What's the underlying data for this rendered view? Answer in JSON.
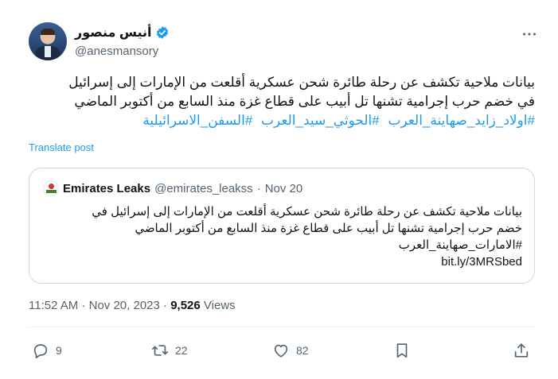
{
  "author": {
    "display_name": "أنيس منصور",
    "handle": "@anesmansory",
    "verified": true
  },
  "tweet": {
    "lines": [
      "بيانات ملاحية تكشف عن رحلة طائرة شحن عسكرية أقلعت من الإمارات إلى إسرائيل",
      "في خضم حرب إجرامية تشنها تل أبيب على قطاع غزة منذ السابع من أكتوبر الماضي"
    ],
    "hashtags": [
      "#اولاد_زايد_صهاينة_العرب",
      "#الحوثي_سيد_العرب",
      "#السفن_الاسرائيلية"
    ],
    "translate_label": "Translate post"
  },
  "quote": {
    "display_name": "Emirates Leaks",
    "handle": "@emirates_leakss",
    "separator": "·",
    "date": "Nov 20",
    "lines": [
      "بيانات ملاحية تكشف عن رحلة طائرة شحن عسكرية أقلعت من الإمارات إلى إسرائيل في",
      "خضم حرب إجرامية تشنها تل أبيب على قطاع غزة منذ السابع من أكتوبر الماضي",
      "#الامارات_صهاينة_العرب"
    ],
    "link": "bit.ly/3MRSbed"
  },
  "meta": {
    "time": "11:52 AM",
    "separator1": "·",
    "date": "Nov 20, 2023",
    "separator2": "·",
    "views_count": "9,526",
    "views_label": "Views"
  },
  "actions": {
    "replies": "9",
    "reposts": "22",
    "likes": "82"
  },
  "colors": {
    "accent": "#1d9bf0",
    "text": "#0f1419",
    "secondary": "#536471",
    "border": "#cfd9de"
  }
}
